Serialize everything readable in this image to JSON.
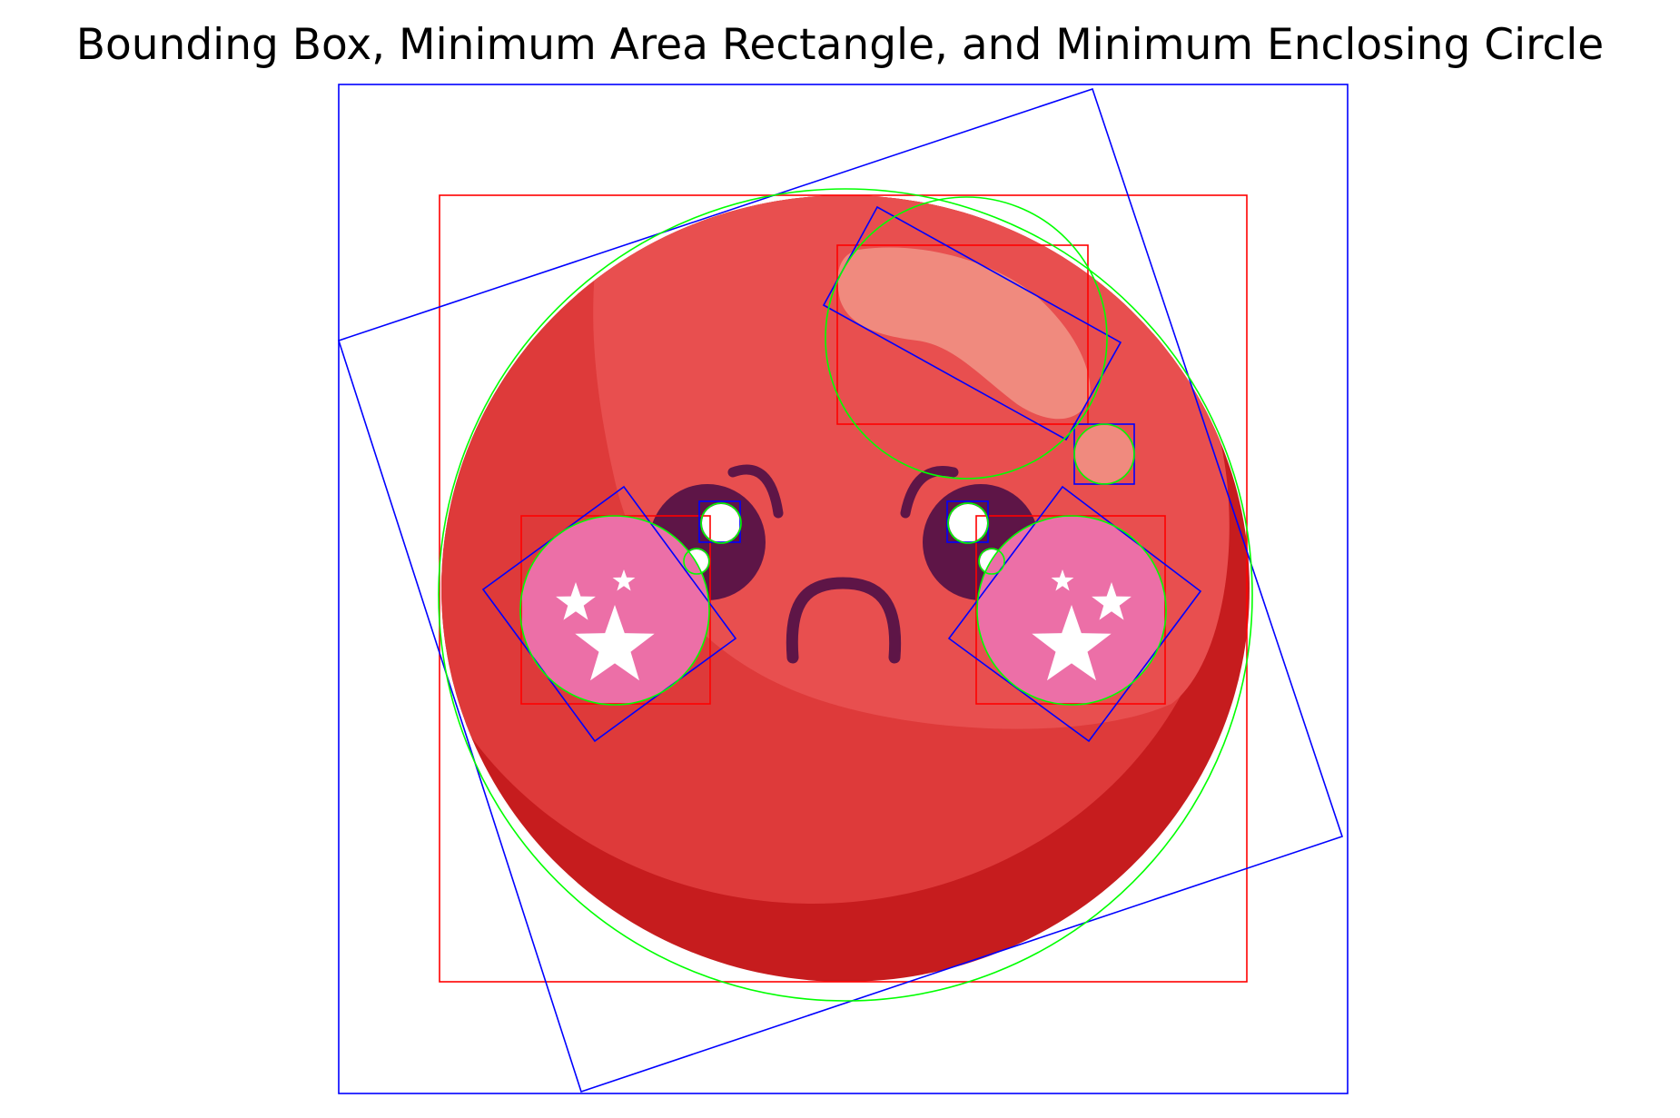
{
  "figure": {
    "title": "Bounding Box, Minimum Area Rectangle, and Minimum Enclosing Circle"
  },
  "legend_colors": {
    "bounding_box": "#ff0000",
    "minimum_area_rectangle": "#0000ff",
    "minimum_enclosing_circle": "#00ff00"
  },
  "emoji": {
    "expression": "sad",
    "body_colors": {
      "light": "#e84f4f",
      "mid": "#de3a3a",
      "dark": "#c61c1e",
      "highlight": "#f08a7e",
      "features": "#5e1547",
      "cheeks": "#ec6fa7",
      "stars": "#ffffff",
      "eye_sparkles": "#ffffff"
    },
    "icon_names": [
      "star-icon",
      "eye-icon",
      "eyebrow-icon",
      "mouth-icon",
      "cheek-icon",
      "highlight-icon"
    ]
  }
}
